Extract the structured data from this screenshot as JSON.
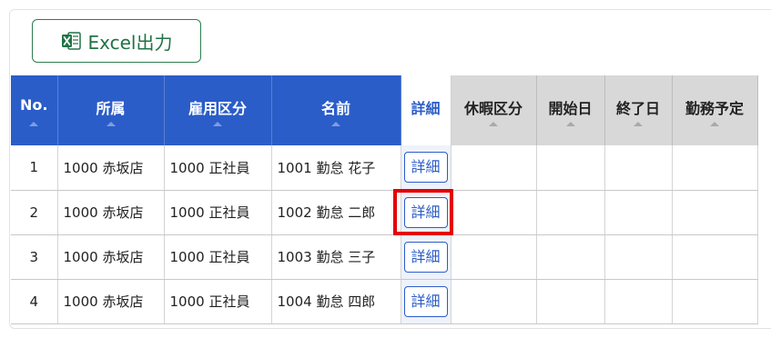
{
  "toolbar": {
    "export_label": "Excel出力"
  },
  "table": {
    "headers": {
      "no": "No.",
      "dept": "所属",
      "employment": "雇用区分",
      "name": "名前",
      "detail": "詳細",
      "leave_type": "休暇区分",
      "start_date": "開始日",
      "end_date": "終了日",
      "work_schedule": "勤務予定"
    },
    "rows": [
      {
        "no": "1",
        "dept": "1000 赤坂店",
        "employment": "1000 正社員",
        "name": "1001 勤怠 花子",
        "detail": "詳細",
        "leave_type": "",
        "start_date": "",
        "end_date": "",
        "work_schedule": ""
      },
      {
        "no": "2",
        "dept": "1000 赤坂店",
        "employment": "1000 正社員",
        "name": "1002 勤怠 二郎",
        "detail": "詳細",
        "leave_type": "",
        "start_date": "",
        "end_date": "",
        "work_schedule": ""
      },
      {
        "no": "3",
        "dept": "1000 赤坂店",
        "employment": "1000 正社員",
        "name": "1003 勤怠 三子",
        "detail": "詳細",
        "leave_type": "",
        "start_date": "",
        "end_date": "",
        "work_schedule": ""
      },
      {
        "no": "4",
        "dept": "1000 赤坂店",
        "employment": "1000 正社員",
        "name": "1004 勤怠 四郎",
        "detail": "詳細",
        "leave_type": "",
        "start_date": "",
        "end_date": "",
        "work_schedule": ""
      }
    ]
  },
  "colors": {
    "header_blue": "#2b5dc8",
    "header_gray": "#d8d8d8",
    "excel_green": "#217346",
    "highlight_red": "#e60000"
  },
  "icons": {
    "export": "excel-icon"
  }
}
